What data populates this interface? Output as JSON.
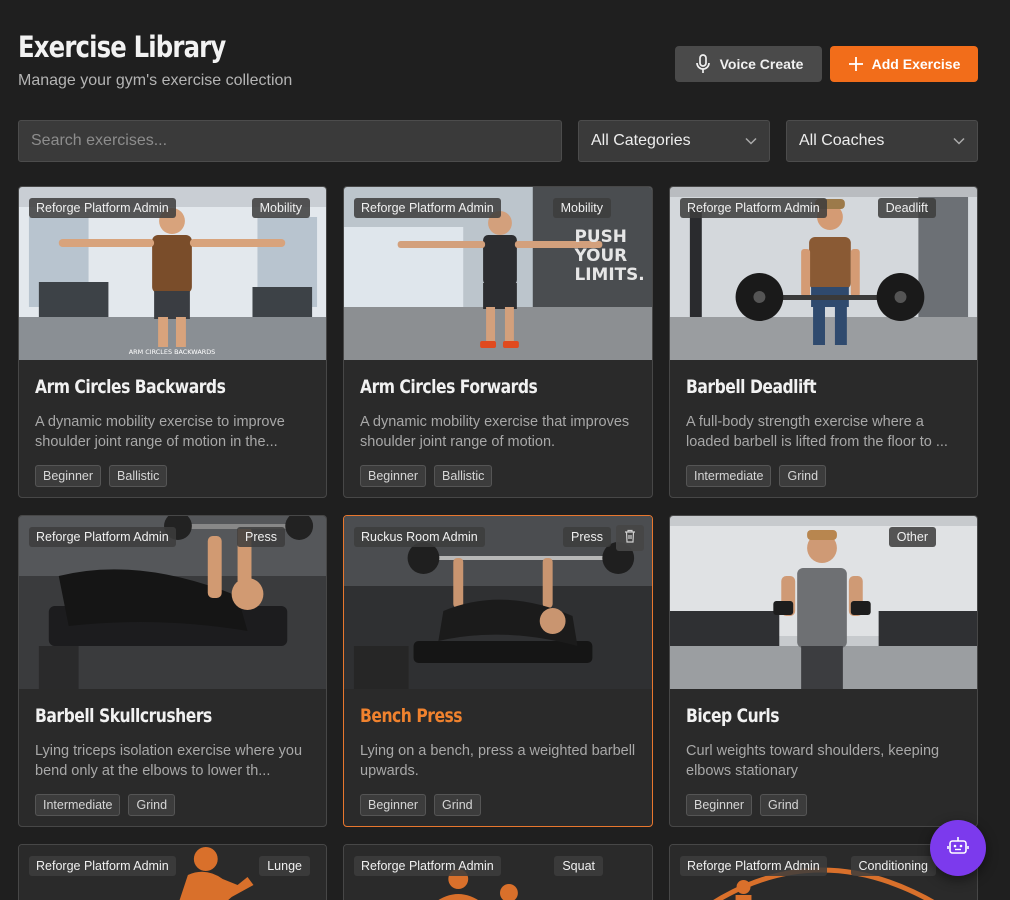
{
  "header": {
    "title": "Exercise Library",
    "subtitle": "Manage your gym's exercise collection",
    "voice_label": "Voice Create",
    "add_label": "Add Exercise",
    "accent": "#f26d1a"
  },
  "filters": {
    "search_placeholder": "Search exercises...",
    "category": "All Categories",
    "coach": "All Coaches"
  },
  "cards": [
    {
      "coach": "Reforge Platform Admin",
      "category": "Mobility",
      "title": "Arm Circles Backwards",
      "description": "A dynamic mobility exercise to improve shoulder joint range of motion in the...",
      "level": "Beginner",
      "type": "Ballistic",
      "image_caption": "ARM CIRCLES BACKWARDS"
    },
    {
      "coach": "Reforge Platform Admin",
      "category": "Mobility",
      "title": "Arm Circles Forwards",
      "description": "A dynamic mobility exercise that improves shoulder joint range of motion.",
      "level": "Beginner",
      "type": "Ballistic",
      "image_caption": "PUSH YOUR LIMITS."
    },
    {
      "coach": "Reforge Platform Admin",
      "category": "Deadlift",
      "title": "Barbell Deadlift",
      "description": "A full-body strength exercise where a loaded barbell is lifted from the floor to ...",
      "level": "Intermediate",
      "type": "Grind"
    },
    {
      "coach": "Reforge Platform Admin",
      "category": "Press",
      "title": "Barbell Skullcrushers",
      "description": "Lying triceps isolation exercise where you bend only at the elbows to lower th...",
      "level": "Intermediate",
      "type": "Grind"
    },
    {
      "coach": "Ruckus Room Admin",
      "category": "Press",
      "title": "Bench Press",
      "description": "Lying on a bench, press a weighted barbell upwards.",
      "level": "Beginner",
      "type": "Grind"
    },
    {
      "coach": "",
      "category": "Other",
      "title": "Bicep Curls",
      "description": "Curl weights toward shoulders, keeping elbows stationary",
      "level": "Beginner",
      "type": "Grind"
    },
    {
      "coach": "Reforge Platform Admin",
      "category": "Lunge"
    },
    {
      "coach": "Reforge Platform Admin",
      "category": "Squat"
    },
    {
      "coach": "Reforge Platform Admin",
      "category": "Conditioning"
    }
  ],
  "icons": {
    "voice": "microphone-icon",
    "add": "plus-icon",
    "dropdown": "chevron-down-icon",
    "delete": "trash-icon",
    "assistant": "robot-icon"
  },
  "colors": {
    "background": "#1f1f1f",
    "card": "#2a2a2a",
    "assistant": "#7c3aed"
  }
}
